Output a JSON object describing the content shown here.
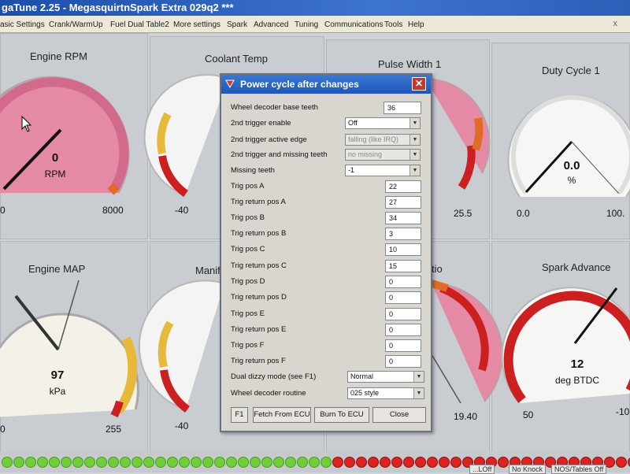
{
  "window": {
    "title": "gaTune 2.25 - MegasquirtnSpark Extra 029q2 ***"
  },
  "menu": {
    "items": [
      "asic Settings",
      "Crank/WarmUp",
      "Fuel Dual Table2",
      "More settings",
      "Spark",
      "Advanced",
      "Tuning",
      "Communications",
      "Tools",
      "Help"
    ],
    "close_glyph": "x"
  },
  "gauges": {
    "rpm": {
      "label": "Engine RPM",
      "value": "0",
      "unit": "RPM",
      "min": "0",
      "max": "8000",
      "fraction": 0.0
    },
    "coolant": {
      "label": "Coolant Temp",
      "min": "-40"
    },
    "pulse": {
      "label": "Pulse Width 1",
      "max": "25.5"
    },
    "duty": {
      "label": "Duty Cycle 1",
      "value": "0.0",
      "unit": "%",
      "min": "0.0",
      "max": "100.",
      "fraction": 0.0
    },
    "map": {
      "label": "Engine MAP",
      "value": "97",
      "unit": "kPa",
      "min": "0",
      "max": "255",
      "fraction": 0.38
    },
    "manifold": {
      "label": "Manif",
      "min": "-40"
    },
    "ratio": {
      "label": "tio",
      "max": "19.40"
    },
    "spark": {
      "label": "Spark Advance",
      "value": "12",
      "unit": "deg BTDC",
      "min": "50",
      "max": "-10"
    }
  },
  "dialog": {
    "title": "Power cycle after changes",
    "fields": [
      {
        "label": "Wheel decoder base teeth",
        "kind": "input",
        "value": "36"
      },
      {
        "label": "2nd trigger enable",
        "kind": "select",
        "value": "Off",
        "disabled": false
      },
      {
        "label": "2nd trigger active edge",
        "kind": "select",
        "value": "falling (like IRQ)",
        "disabled": true
      },
      {
        "label": "2nd trigger and missing teeth",
        "kind": "select",
        "value": "no missing",
        "disabled": true
      },
      {
        "label": "Missing teeth",
        "kind": "select",
        "value": "-1",
        "disabled": false
      },
      {
        "label": "Trig pos A",
        "kind": "input",
        "value": "22"
      },
      {
        "label": "Trig return pos A",
        "kind": "input",
        "value": "27"
      },
      {
        "label": "Trig pos B",
        "kind": "input",
        "value": "34"
      },
      {
        "label": "Trig return pos B",
        "kind": "input",
        "value": "3"
      },
      {
        "label": "Trig pos C",
        "kind": "input",
        "value": "10"
      },
      {
        "label": "Trig return pos C",
        "kind": "input",
        "value": "15"
      },
      {
        "label": "Trig pos D",
        "kind": "input",
        "value": "0"
      },
      {
        "label": "Trig return pos D",
        "kind": "input",
        "value": "0"
      },
      {
        "label": "Trig pos E",
        "kind": "input",
        "value": "0"
      },
      {
        "label": "Trig return pos E",
        "kind": "input",
        "value": "0"
      },
      {
        "label": "Trig pos F",
        "kind": "input",
        "value": "0"
      },
      {
        "label": "Trig return pos F",
        "kind": "input",
        "value": "0"
      },
      {
        "label": "Dual dizzy mode (see F1)",
        "kind": "select",
        "value": "Normal",
        "disabled": false
      },
      {
        "label": "Wheel decoder routine",
        "kind": "select",
        "value": "025 style",
        "disabled": false
      }
    ],
    "buttons": {
      "f1": "F1",
      "fetch": "Fetch From ECU",
      "burn": "Burn To ECU",
      "close": "Close"
    }
  },
  "status": {
    "box1": "...LOff",
    "box2": "No Knock",
    "box3": "NOS/Tables Off"
  },
  "leds": {
    "green_count": 28,
    "red_count": 27
  },
  "colors": {
    "gauge_pink": "#e48aa4",
    "gauge_red": "#cc1f1f",
    "gauge_yellow": "#e6b93a",
    "title_blue": "#1f56b8"
  }
}
